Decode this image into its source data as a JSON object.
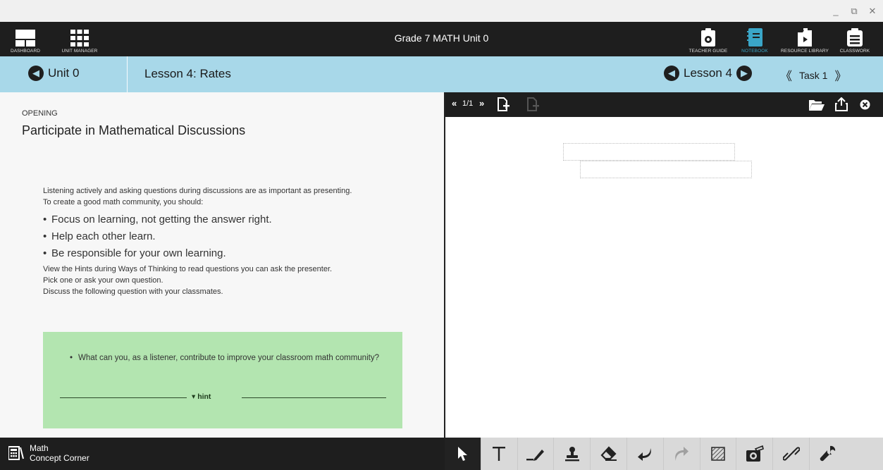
{
  "window": {
    "minimize": "_",
    "restore": "⧉",
    "close": "✕"
  },
  "topbar": {
    "title": "Grade 7 MATH Unit 0",
    "left_buttons": [
      {
        "label": "DASHBOARD",
        "icon": "dashboard-icon"
      },
      {
        "label": "UNIT MANAGER",
        "icon": "grid-icon"
      }
    ],
    "right_buttons": [
      {
        "label": "TEACHER GUIDE",
        "icon": "teacher-guide-icon"
      },
      {
        "label": "NOTEBOOK",
        "icon": "notebook-icon"
      },
      {
        "label": "RESOURCE LIBRARY",
        "icon": "resource-library-icon"
      },
      {
        "label": "CLASSWORK",
        "icon": "classwork-icon"
      }
    ]
  },
  "lessonbar": {
    "unit_label": "Unit 0",
    "lesson_title": "Lesson 4: Rates",
    "lesson_nav_label": "Lesson 4",
    "task_label": "Task 1",
    "task_prev": "《",
    "task_next": "》"
  },
  "content": {
    "section_label": "OPENING",
    "section_title": "Participate in Mathematical Discussions",
    "para1": "Listening actively and asking questions during discussions are as important as presenting.",
    "para2": "To create a good math community, you should:",
    "bullets": [
      "Focus on learning, not getting the answer right.",
      "Help each other learn.",
      "Be responsible for your own learning."
    ],
    "para3": "View the Hints during Ways of Thinking to read questions you can ask the presenter.",
    "para4": "Pick one or ask your own question.",
    "para5": "Discuss the following question with your classmates.",
    "question": "What can you, as a listener, contribute to improve your classroom math community?",
    "hint_label": "▾ hint"
  },
  "right_toolbar": {
    "page_prev": "«",
    "page_indicator": "1/1",
    "page_next": "»"
  },
  "bottombar": {
    "concept_line1": "Math",
    "concept_line2": "Concept Corner",
    "tools": [
      {
        "name": "select-tool",
        "icon": "pointer-icon"
      },
      {
        "name": "text-tool",
        "icon": "text-icon"
      },
      {
        "name": "pen-tool",
        "icon": "pen-icon"
      },
      {
        "name": "stamp-tool",
        "icon": "stamp-icon"
      },
      {
        "name": "eraser-tool",
        "icon": "eraser-icon"
      },
      {
        "name": "undo-tool",
        "icon": "undo-icon"
      },
      {
        "name": "redo-tool",
        "icon": "redo-icon"
      },
      {
        "name": "fill-tool",
        "icon": "hatch-icon"
      },
      {
        "name": "camera-tool",
        "icon": "camera-icon"
      },
      {
        "name": "link-tool",
        "icon": "link-icon"
      },
      {
        "name": "settings-tool",
        "icon": "wrench-icon"
      }
    ]
  },
  "colors": {
    "dark_bar": "#1e1e1e",
    "lesson_bar": "#a8d8e9",
    "green_box": "#b3e5b0",
    "tools_bg": "#d9d9d9"
  }
}
